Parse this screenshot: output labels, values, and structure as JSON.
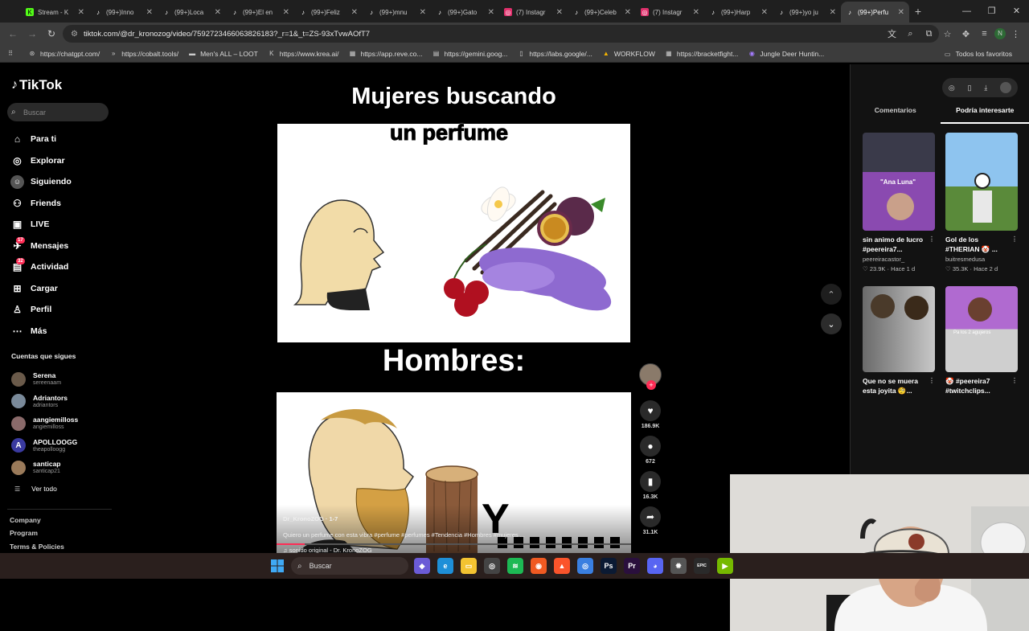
{
  "browser": {
    "tabs": [
      {
        "label": "Stream - K",
        "icon": "kick-icon",
        "color": "#53fc18"
      },
      {
        "label": "(99+)Inno",
        "icon": "tiktok-icon",
        "color": "#ffffff"
      },
      {
        "label": "(99+)Loca",
        "icon": "tiktok-icon",
        "color": "#ffffff"
      },
      {
        "label": "(99+)El en",
        "icon": "tiktok-icon",
        "color": "#ffffff"
      },
      {
        "label": "(99+)Feliz",
        "icon": "tiktok-icon",
        "color": "#ffffff"
      },
      {
        "label": "(99+)mnu",
        "icon": "tiktok-icon",
        "color": "#ffffff"
      },
      {
        "label": "(99+)Gato",
        "icon": "tiktok-icon",
        "color": "#ffffff"
      },
      {
        "label": "(7) Instagr",
        "icon": "instagram-icon",
        "color": "#e1306c"
      },
      {
        "label": "(99+)Celeb",
        "icon": "tiktok-icon",
        "color": "#ffffff"
      },
      {
        "label": "(7) Instagr",
        "icon": "instagram-icon",
        "color": "#e1306c"
      },
      {
        "label": "(99+)Harp",
        "icon": "tiktok-icon",
        "color": "#ffffff"
      },
      {
        "label": "(99+)yo ju",
        "icon": "tiktok-icon",
        "color": "#ffffff"
      },
      {
        "label": "(99+)Perfu",
        "icon": "tiktok-icon",
        "color": "#ffffff",
        "active": true
      }
    ],
    "url": "tiktok.com/@dr_kronozog/video/7592723466063826183?_r=1&_t=ZS-93xTvwAOfT7",
    "profile_initial": "N",
    "bookmarks": [
      {
        "label": "https://chatgpt.com/",
        "icon": "chatgpt-icon"
      },
      {
        "label": "https://cobalt.tools/",
        "icon": "cobalt-icon"
      },
      {
        "label": "Men's ALL – LOOT",
        "icon": "loot-icon"
      },
      {
        "label": "https://www.krea.ai/",
        "icon": "krea-icon"
      },
      {
        "label": "https://app.reve.co...",
        "icon": "reve-icon"
      },
      {
        "label": "https://gemini.goog...",
        "icon": "gemini-icon"
      },
      {
        "label": "https://labs.google/...",
        "icon": "labs-icon"
      },
      {
        "label": "WORKFLOW",
        "icon": "drive-icon"
      },
      {
        "label": "https://bracketfight...",
        "icon": "bracket-icon"
      },
      {
        "label": "Jungle Deer Huntin...",
        "icon": "game-icon"
      }
    ],
    "all_bookmarks": "Todos los favoritos"
  },
  "sidebar": {
    "brand": "TikTok",
    "search_placeholder": "Buscar",
    "nav": [
      {
        "label": "Para ti",
        "icon": "home-icon"
      },
      {
        "label": "Explorar",
        "icon": "compass-icon"
      },
      {
        "label": "Siguiendo",
        "icon": "following-icon"
      },
      {
        "label": "Friends",
        "icon": "friends-icon"
      },
      {
        "label": "LIVE",
        "icon": "live-icon"
      },
      {
        "label": "Mensajes",
        "icon": "messages-icon",
        "badge": "17"
      },
      {
        "label": "Actividad",
        "icon": "activity-icon",
        "badge": "32"
      },
      {
        "label": "Cargar",
        "icon": "upload-icon"
      },
      {
        "label": "Perfil",
        "icon": "profile-icon"
      },
      {
        "label": "Más",
        "icon": "more-icon"
      }
    ],
    "following_title": "Cuentas que sigues",
    "accounts": [
      {
        "name": "Serena",
        "handle": "sereenaam"
      },
      {
        "name": "Adriantors",
        "handle": "adriantors"
      },
      {
        "name": "aangiemilloss",
        "handle": "angiemilloss"
      },
      {
        "name": "APOLLOOGG",
        "handle": "theapolloogg",
        "initial": "A"
      },
      {
        "name": "santicap",
        "handle": "santicap21"
      }
    ],
    "see_all": "Ver todo",
    "footer": [
      "Company",
      "Program",
      "Terms & Policies"
    ]
  },
  "video": {
    "top_title": "Mujeres buscando",
    "subtitle": "un perfume",
    "mid_title": "Hombres:",
    "overlay_letter": "Y",
    "author": "Dr_KronoZOG · 1-7",
    "caption": "Quiero un perfume con esta vibra #perfume #perfumes #Tendencia #Hombres #mujeres ...",
    "sound": "sonido original - Dr. KronoZOG",
    "progress": 0.08
  },
  "actions": [
    {
      "icon": "heart-icon",
      "count": "186.9K",
      "glyph": "♥"
    },
    {
      "icon": "comment-icon",
      "count": "672",
      "glyph": "●"
    },
    {
      "icon": "bookmark-icon",
      "count": "16.3K",
      "glyph": "▮"
    },
    {
      "icon": "share-icon",
      "count": "31.1K",
      "glyph": "➦"
    }
  ],
  "right_panel": {
    "tabs": [
      "Comentarios",
      "Podría interesarte"
    ],
    "active_tab": 1,
    "recs": [
      {
        "caption": "sin animo de lucro #peereira7...",
        "author": "peereiracastor_",
        "likes": "23.9K",
        "age": "Hace 1 d",
        "thumb_text": "\"Ana Luna\""
      },
      {
        "caption": "Gol de los #THERIAN 🤡 ...",
        "author": "buitresmedusa",
        "likes": "35.3K",
        "age": "Hace 2 d"
      },
      {
        "caption": "Que no se muera esta joyita 🧐...",
        "author": "",
        "likes": "",
        "age": ""
      },
      {
        "caption": "🤡 #peereira7 #twitchclips...",
        "author": "",
        "likes": "",
        "age": "",
        "thumb_text": "Pa los 2 agujeros"
      }
    ]
  },
  "taskbar": {
    "search": "Buscar",
    "apps": [
      {
        "icon": "copilot-icon",
        "color": "#6b5bd6",
        "glyph": "◆"
      },
      {
        "icon": "edge-icon",
        "color": "#1e8fd8",
        "glyph": "e"
      },
      {
        "icon": "explorer-icon",
        "color": "#f3c331",
        "glyph": "▭"
      },
      {
        "icon": "obs-icon",
        "color": "#444444",
        "glyph": "◎"
      },
      {
        "icon": "spotify-icon",
        "color": "#1db954",
        "glyph": "≋"
      },
      {
        "icon": "origin-icon",
        "color": "#f05a22",
        "glyph": "◉"
      },
      {
        "icon": "brave-icon",
        "color": "#fb542b",
        "glyph": "▲"
      },
      {
        "icon": "chrome-icon",
        "color": "#3a7fe0",
        "glyph": "◎"
      },
      {
        "icon": "photoshop-icon",
        "color": "#0b1a33",
        "glyph": "Ps"
      },
      {
        "icon": "premiere-icon",
        "color": "#2a0f3d",
        "glyph": "Pr"
      },
      {
        "icon": "discord-icon",
        "color": "#5865f2",
        "glyph": "◕"
      },
      {
        "icon": "settings-icon",
        "color": "#555555",
        "glyph": "✹"
      },
      {
        "icon": "epic-icon",
        "color": "#2a2a2a",
        "glyph": "EPIC"
      },
      {
        "icon": "nvidia-icon",
        "color": "#76b900",
        "glyph": "▶"
      }
    ]
  }
}
